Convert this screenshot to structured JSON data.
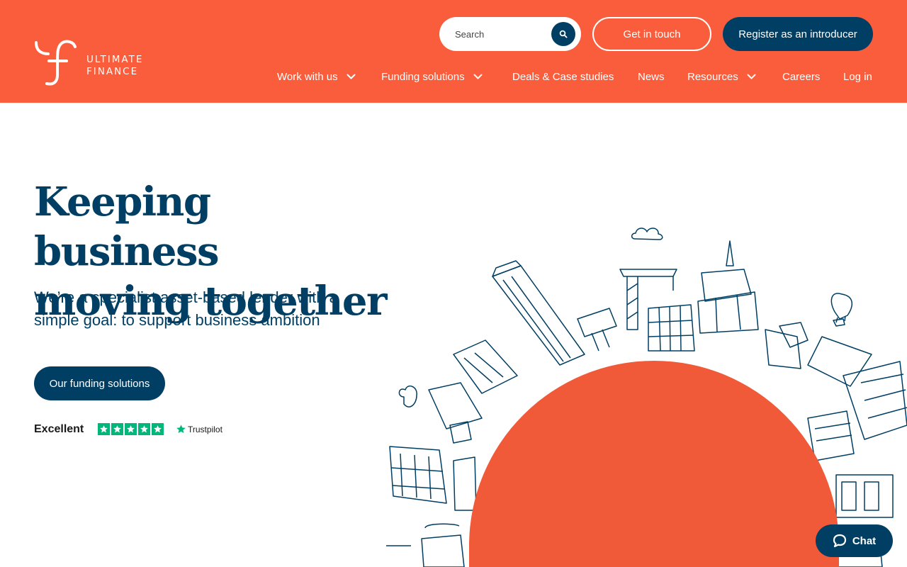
{
  "brand": {
    "line1": "ULTIMATE",
    "line2": "FINANCE"
  },
  "colors": {
    "primary": "#f95d3c",
    "navy": "#003e63",
    "sun": "#f05a38",
    "trustpilot": "#00b67a"
  },
  "header": {
    "search": {
      "placeholder": "Search",
      "value": ""
    },
    "get_in_touch": "Get in touch",
    "register": "Register as an introducer"
  },
  "nav": [
    {
      "label": "Work with us",
      "dropdown": true
    },
    {
      "label": "Funding solutions",
      "dropdown": true
    },
    {
      "label": "Deals & Case studies",
      "dropdown": false
    },
    {
      "label": "News",
      "dropdown": false
    },
    {
      "label": "Resources",
      "dropdown": true
    },
    {
      "label": "Careers",
      "dropdown": false
    },
    {
      "label": "Log in",
      "dropdown": false
    }
  ],
  "hero": {
    "title_line1": "Keeping business",
    "title_line2": "moving together",
    "subtitle": "We’re a specialist asset-based lender with a simple goal: to support business ambition",
    "cta": "Our funding solutions"
  },
  "trustpilot": {
    "rating_word": "Excellent",
    "stars": 5,
    "brand": "Trustpilot"
  },
  "chat": {
    "label": "Chat"
  },
  "icons": [
    "logo-mark-icon",
    "search-icon",
    "chevron-down-icon",
    "star-icon",
    "chat-bubble-icon",
    "city-illustration"
  ]
}
